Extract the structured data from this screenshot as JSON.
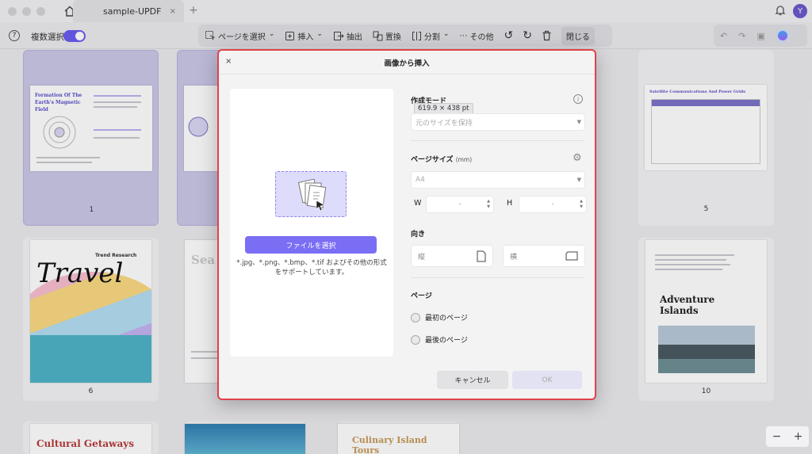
{
  "titlebar": {
    "tab_title": "sample-UPDF",
    "tab_close": "×",
    "new_tab": "+",
    "user_initial": "Y"
  },
  "toolbar": {
    "multi_select_label": "複数選択",
    "page_select": "ページを選択",
    "insert": "挿入",
    "extract": "抽出",
    "replace": "置換",
    "split": "分割",
    "more": "その他",
    "close": "閉じる"
  },
  "pages": {
    "p1_title": "Formation Of The Earth's Magnetic Field",
    "p1_num": "1",
    "p2_title": "Sea",
    "p5_title": "Satellite Communications And Power Grids",
    "p5_num": "5",
    "p6_title": "Travel",
    "p6_sub": "Trend Research",
    "p6_num": "6",
    "p10_title": "Adventure Islands",
    "p10_num": "10",
    "p11_title": "Cultural Getaways",
    "p13_title": "Culinary Island Tours"
  },
  "dialog": {
    "title": "画像から挿入",
    "close": "×",
    "select_file_button": "ファイルを選択",
    "supported_formats": "*.jpg、*.png、*.bmp、*.tif およびその他の形式をサポートしています。",
    "creation_mode_label": "作成モード",
    "size_tooltip": "619.9 × 438 pt",
    "creation_mode_value": "元のサイズを保持",
    "page_size_label": "ページサイズ",
    "page_size_unit": "(mm)",
    "page_size_value": "A4",
    "width_label": "W",
    "width_value": "-",
    "height_label": "H",
    "height_value": "-",
    "orientation_label": "向き",
    "portrait": "縦",
    "landscape": "横",
    "page_label": "ページ",
    "first_page": "最初のページ",
    "last_page": "最後のページ",
    "cancel": "キャンセル",
    "ok": "OK"
  },
  "zoom": {
    "minus": "−",
    "plus": "+"
  }
}
